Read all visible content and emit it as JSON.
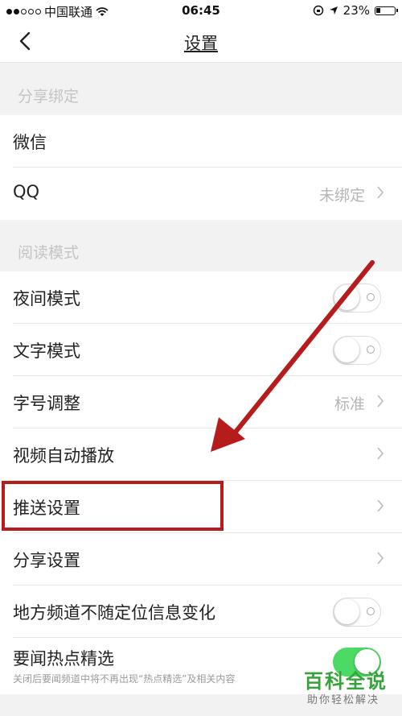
{
  "status_bar": {
    "carrier": "中国联通",
    "time": "06:45",
    "battery": "23%"
  },
  "nav": {
    "title": "设置"
  },
  "sections": {
    "share_binding": "分享绑定",
    "reading_mode": "阅读模式"
  },
  "rows": {
    "wechat": {
      "label": "微信"
    },
    "qq": {
      "label": "QQ",
      "value": "未绑定"
    },
    "night_mode": {
      "label": "夜间模式",
      "toggle_on": false
    },
    "text_mode": {
      "label": "文字模式",
      "toggle_on": false
    },
    "font_size": {
      "label": "字号调整",
      "value": "标准"
    },
    "video_autoplay": {
      "label": "视频自动播放"
    },
    "push_settings": {
      "label": "推送设置"
    },
    "share_settings": {
      "label": "分享设置"
    },
    "local_channel": {
      "label": "地方频道不随定位信息变化",
      "toggle_on": false
    },
    "hot_news": {
      "label": "要闻热点精选",
      "sub": "关闭后要闻频道中将不再出现“热点精选”及相关内容",
      "toggle_on": true
    }
  },
  "watermark": {
    "title": "百科全说",
    "subtitle": "助你轻松解决"
  },
  "colors": {
    "annotation_red": "#b71c1c",
    "toggle_green": "#4cd964"
  },
  "icons": [
    "back-icon",
    "chevron-right-icon",
    "wifi-icon",
    "location-icon",
    "lock-rotation-icon",
    "battery-icon"
  ]
}
